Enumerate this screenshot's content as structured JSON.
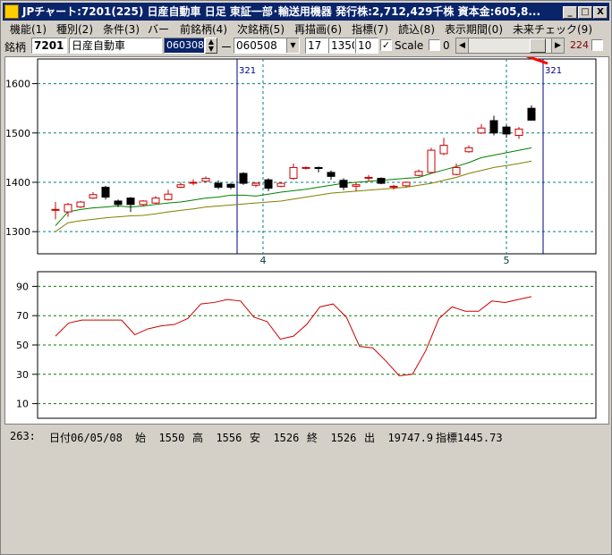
{
  "window": {
    "title": "JPチャート:7201(225) 日産自動車 日足 東証一部･輸送用機器 発行株:2,712,429千株 資本金:605,8...",
    "controls": {
      "minimize": "_",
      "maximize": "□",
      "close": "X"
    }
  },
  "menu": [
    "機能(1)",
    "種別(2)",
    "条件(3)",
    "バー",
    "前銘柄(4)",
    "次銘柄(5)",
    "再描画(6)",
    "指標(7)",
    "読込(8)",
    "表示期間(0)",
    "未来チェック(9)"
  ],
  "toolbar": {
    "label_code": "銘柄",
    "code": "7201",
    "name": "日産自動車",
    "start_date": "060308",
    "dash": "ー",
    "end_date": "060508",
    "param1": "17",
    "param2": "1350",
    "param3": "10",
    "scale_label": "Scale",
    "scale_checked": "✓",
    "zero_label": "0",
    "right_value": "224",
    "scroll_left": "◀",
    "scroll_right": "▶"
  },
  "status": {
    "index": "263:",
    "date": "日付06/05/08",
    "open": "始  1550",
    "high": "高  1556",
    "low": "安  1526",
    "close": "終  1526",
    "volume": "出  19747.9",
    "indicator": "指標1445.73"
  },
  "chart_data": [
    {
      "type": "candlestick",
      "y_ticks": [
        "1600",
        "1500",
        "1400",
        "1300"
      ],
      "ylim": [
        1255,
        1650
      ],
      "x_ticks": [
        "4",
        "5"
      ],
      "markers": [
        "321",
        "321"
      ],
      "colors": {
        "up": "#cc0000",
        "down": "#000000",
        "ma_short": "#008000",
        "ma_long": "#808000",
        "grid": "#008080",
        "marker": "#000080",
        "trend": "#ff0000"
      },
      "candles": [
        {
          "o": 1345,
          "c": 1345,
          "h": 1360,
          "l": 1325
        },
        {
          "o": 1340,
          "c": 1355,
          "h": 1358,
          "l": 1330
        },
        {
          "o": 1350,
          "c": 1360,
          "h": 1362,
          "l": 1348
        },
        {
          "o": 1368,
          "c": 1375,
          "h": 1380,
          "l": 1366
        },
        {
          "o": 1390,
          "c": 1370,
          "h": 1393,
          "l": 1365
        },
        {
          "o": 1362,
          "c": 1355,
          "h": 1365,
          "l": 1350
        },
        {
          "o": 1368,
          "c": 1355,
          "h": 1370,
          "l": 1340
        },
        {
          "o": 1355,
          "c": 1362,
          "h": 1364,
          "l": 1352
        },
        {
          "o": 1358,
          "c": 1368,
          "h": 1372,
          "l": 1356
        },
        {
          "o": 1365,
          "c": 1376,
          "h": 1385,
          "l": 1363
        },
        {
          "o": 1390,
          "c": 1395,
          "h": 1400,
          "l": 1388
        },
        {
          "o": 1400,
          "c": 1400,
          "h": 1406,
          "l": 1394
        },
        {
          "o": 1402,
          "c": 1408,
          "h": 1412,
          "l": 1400
        },
        {
          "o": 1398,
          "c": 1390,
          "h": 1404,
          "l": 1386
        },
        {
          "o": 1396,
          "c": 1390,
          "h": 1398,
          "l": 1386
        },
        {
          "o": 1418,
          "c": 1398,
          "h": 1420,
          "l": 1395
        },
        {
          "o": 1394,
          "c": 1398,
          "h": 1400,
          "l": 1390
        },
        {
          "o": 1405,
          "c": 1388,
          "h": 1408,
          "l": 1382
        },
        {
          "o": 1392,
          "c": 1398,
          "h": 1400,
          "l": 1390
        },
        {
          "o": 1408,
          "c": 1430,
          "h": 1438,
          "l": 1405
        },
        {
          "o": 1430,
          "c": 1430,
          "h": 1432,
          "l": 1426
        },
        {
          "o": 1430,
          "c": 1428,
          "h": 1432,
          "l": 1420
        },
        {
          "o": 1420,
          "c": 1412,
          "h": 1424,
          "l": 1405
        },
        {
          "o": 1404,
          "c": 1390,
          "h": 1408,
          "l": 1384
        },
        {
          "o": 1392,
          "c": 1395,
          "h": 1400,
          "l": 1382
        },
        {
          "o": 1410,
          "c": 1410,
          "h": 1415,
          "l": 1402
        },
        {
          "o": 1408,
          "c": 1398,
          "h": 1410,
          "l": 1396
        },
        {
          "o": 1392,
          "c": 1392,
          "h": 1395,
          "l": 1385
        },
        {
          "o": 1393,
          "c": 1400,
          "h": 1402,
          "l": 1390
        },
        {
          "o": 1414,
          "c": 1422,
          "h": 1426,
          "l": 1412
        },
        {
          "o": 1420,
          "c": 1465,
          "h": 1470,
          "l": 1418
        },
        {
          "o": 1458,
          "c": 1475,
          "h": 1490,
          "l": 1455
        },
        {
          "o": 1416,
          "c": 1430,
          "h": 1438,
          "l": 1414
        },
        {
          "o": 1462,
          "c": 1470,
          "h": 1475,
          "l": 1460
        },
        {
          "o": 1500,
          "c": 1510,
          "h": 1518,
          "l": 1498
        },
        {
          "o": 1525,
          "c": 1500,
          "h": 1535,
          "l": 1495
        },
        {
          "o": 1512,
          "c": 1498,
          "h": 1516,
          "l": 1490
        },
        {
          "o": 1495,
          "c": 1508,
          "h": 1512,
          "l": 1488
        },
        {
          "o": 1550,
          "c": 1526,
          "h": 1556,
          "l": 1526
        }
      ],
      "ma_short": [
        1312,
        1340,
        1345,
        1348,
        1350,
        1352,
        1350,
        1352,
        1355,
        1358,
        1360,
        1364,
        1368,
        1370,
        1374,
        1374,
        1372,
        1376,
        1380,
        1383,
        1386,
        1390,
        1394,
        1398,
        1400,
        1402,
        1404,
        1406,
        1408,
        1410,
        1418,
        1425,
        1432,
        1440,
        1450,
        1455,
        1460,
        1465,
        1470
      ],
      "ma_long": [
        1300,
        1318,
        1322,
        1325,
        1328,
        1330,
        1332,
        1333,
        1336,
        1340,
        1343,
        1346,
        1350,
        1352,
        1354,
        1356,
        1358,
        1360,
        1362,
        1366,
        1370,
        1374,
        1378,
        1380,
        1382,
        1384,
        1386,
        1388,
        1390,
        1394,
        1398,
        1404,
        1410,
        1418,
        1424,
        1430,
        1434,
        1438,
        1443
      ]
    },
    {
      "type": "line",
      "y_ticks": [
        "90",
        "70",
        "50",
        "30",
        "10"
      ],
      "ylim": [
        0,
        100
      ],
      "values": [
        56,
        65,
        67,
        67,
        67,
        67,
        57,
        61,
        63,
        64,
        68,
        78,
        79,
        81,
        80,
        69,
        66,
        54,
        56,
        64,
        76,
        78,
        69,
        49,
        48,
        39,
        29,
        30,
        46,
        68,
        76,
        73,
        73,
        80,
        79,
        81,
        83
      ]
    }
  ]
}
